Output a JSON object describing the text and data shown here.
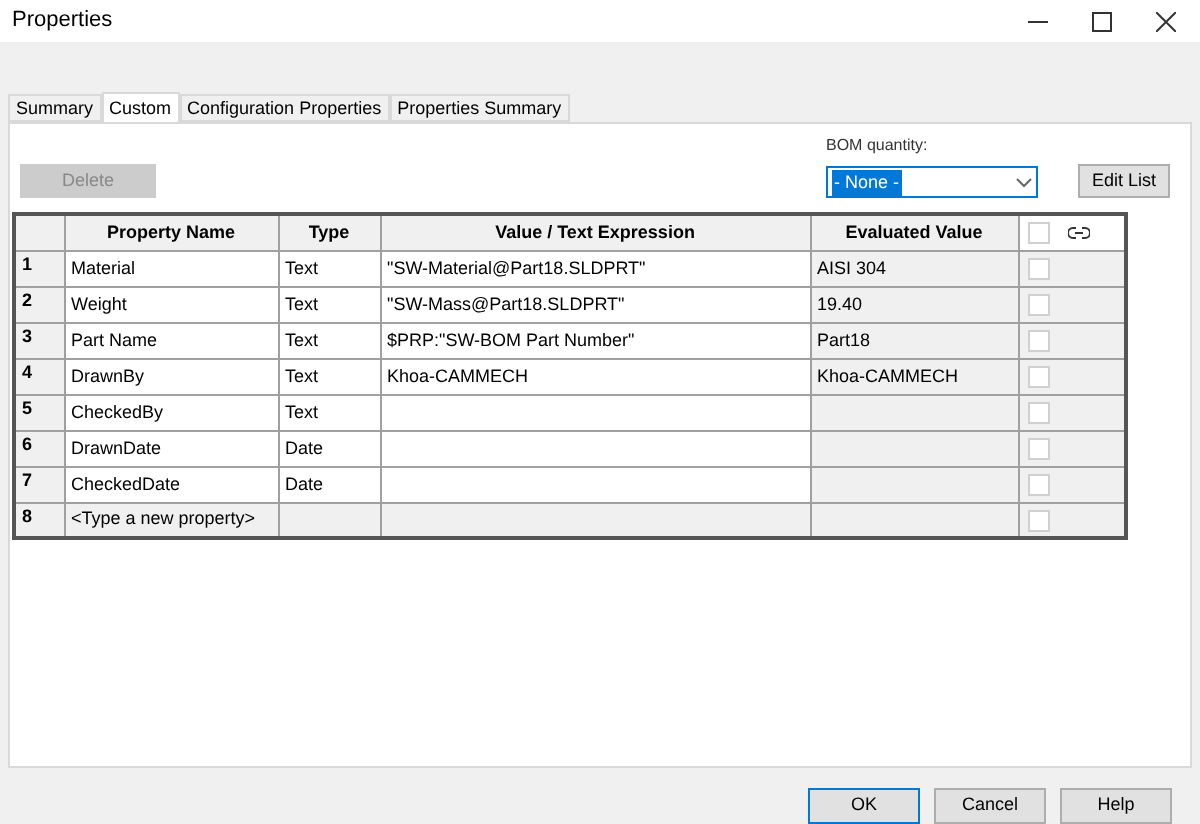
{
  "window": {
    "title": "Properties"
  },
  "tabs": [
    {
      "label": "Summary",
      "selected": false
    },
    {
      "label": "Custom",
      "selected": true
    },
    {
      "label": "Configuration Properties",
      "selected": false
    },
    {
      "label": "Properties Summary",
      "selected": false
    }
  ],
  "delete_button": {
    "label": "Delete",
    "disabled": true
  },
  "bom_quantity": {
    "label": "BOM quantity:",
    "value": "- None -"
  },
  "edit_list_button": {
    "label": "Edit List"
  },
  "table": {
    "columns": [
      "Property Name",
      "Type",
      "Value / Text Expression",
      "Evaluated Value"
    ],
    "header_checked": false,
    "rows": [
      {
        "number": "1",
        "name": "Material",
        "type": "Text",
        "value": "\"SW-Material@Part18.SLDPRT\"",
        "evaluated": "AISI 304",
        "checked": false
      },
      {
        "number": "2",
        "name": "Weight",
        "type": "Text",
        "value": "\"SW-Mass@Part18.SLDPRT\"",
        "evaluated": "19.40",
        "checked": false
      },
      {
        "number": "3",
        "name": "Part Name",
        "type": "Text",
        "value": "$PRP:\"SW-BOM Part Number\"",
        "evaluated": "Part18",
        "checked": false
      },
      {
        "number": "4",
        "name": "DrawnBy",
        "type": "Text",
        "value": "Khoa-CAMMECH",
        "evaluated": "Khoa-CAMMECH",
        "checked": false
      },
      {
        "number": "5",
        "name": "CheckedBy",
        "type": "Text",
        "value": "",
        "evaluated": "",
        "checked": false
      },
      {
        "number": "6",
        "name": "DrawnDate",
        "type": "Date",
        "value": "",
        "evaluated": "",
        "checked": false
      },
      {
        "number": "7",
        "name": "CheckedDate",
        "type": "Date",
        "value": "",
        "evaluated": "",
        "checked": false
      },
      {
        "number": "8",
        "name": "<Type a new property>",
        "type": "",
        "value": "",
        "evaluated": "",
        "checked": false,
        "kind": "new"
      }
    ]
  },
  "buttons": [
    {
      "label": "OK",
      "default": true
    },
    {
      "label": "Cancel",
      "default": false
    },
    {
      "label": "Help",
      "default": false
    }
  ]
}
